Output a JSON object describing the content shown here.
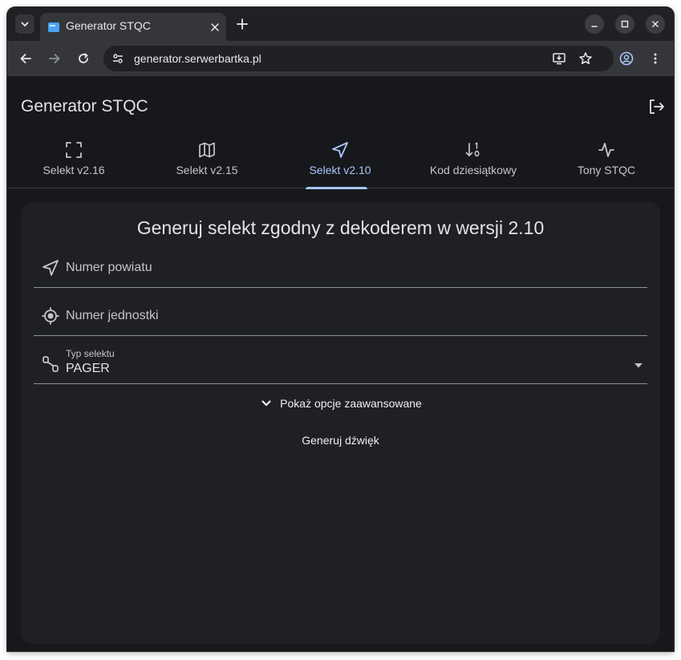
{
  "browser": {
    "tab_title": "Generator STQC",
    "url": "generator.serwerbartka.pl"
  },
  "app": {
    "title": "Generator STQC"
  },
  "tabs": [
    {
      "label": "Selekt v2.16",
      "icon": "fullscreen-icon"
    },
    {
      "label": "Selekt v2.15",
      "icon": "map-icon"
    },
    {
      "label": "Selekt v2.10",
      "icon": "navigation-icon",
      "active": true
    },
    {
      "label": "Kod dziesiątkowy",
      "icon": "sort-numeric-icon"
    },
    {
      "label": "Tony STQC",
      "icon": "pulse-icon"
    }
  ],
  "form": {
    "title": "Generuj selekt zgodny z dekoderem w wersji 2.10",
    "county_placeholder": "Numer powiatu",
    "unit_placeholder": "Numer jednostki",
    "type_label": "Typ selektu",
    "type_value": "PAGER",
    "advanced_label": "Pokaż opcje zaawansowane",
    "generate_label": "Generuj dźwięk"
  },
  "colors": {
    "accent": "#a8c7fa",
    "background": "#17181c",
    "card": "#1f2024"
  }
}
